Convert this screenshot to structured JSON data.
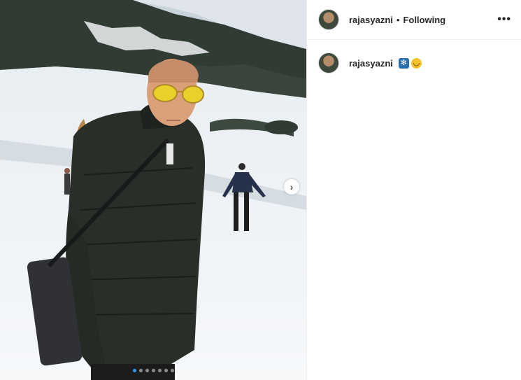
{
  "post": {
    "header": {
      "username": "rajasyazni",
      "separator": "•",
      "follow_status": "Following",
      "more_label": "•••"
    },
    "caption": {
      "username": "rajasyazni",
      "emoji": [
        "snowflake",
        "smiling-face-with-sunglasses"
      ]
    },
    "carousel": {
      "slide_count": 7,
      "current_slide": 1,
      "next_glyph": "›"
    },
    "colors": {
      "active_dot": "#2e9bf0",
      "text": "#262626",
      "border": "#efefef"
    }
  }
}
